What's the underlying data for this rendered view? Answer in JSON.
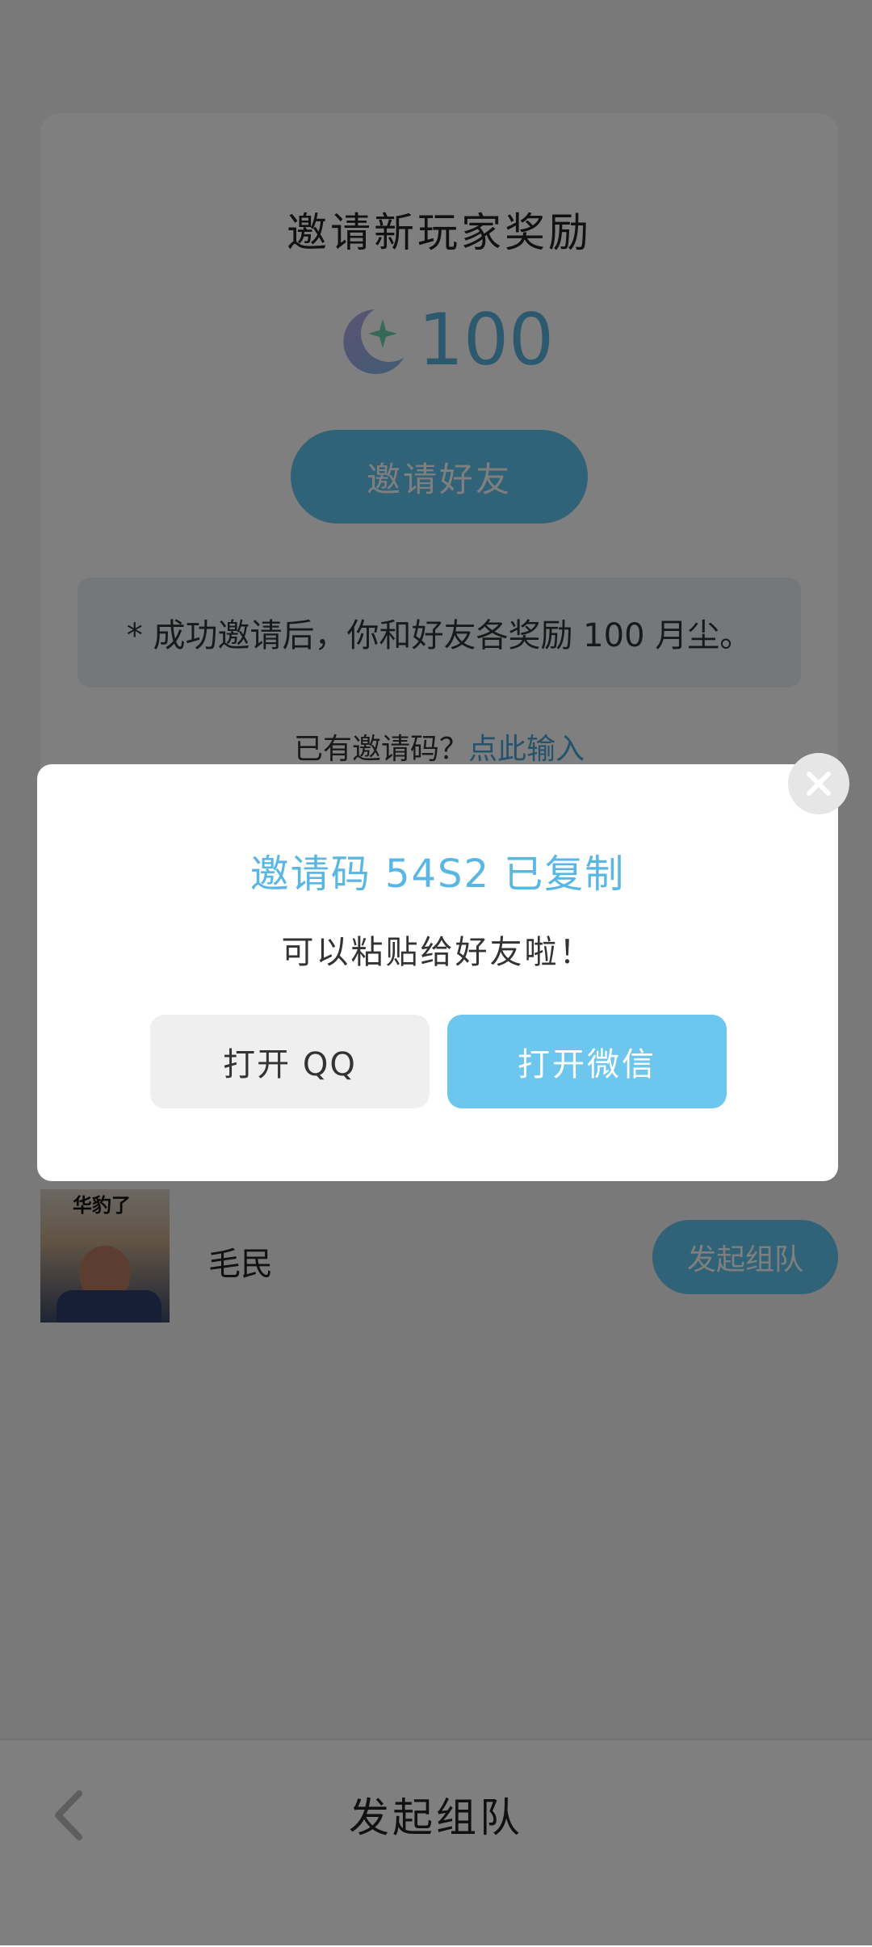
{
  "card": {
    "title": "邀请新玩家奖励",
    "reward_amount": "100",
    "reward_icon": "moon-star-icon",
    "invite_button": "邀请好友",
    "note": "* 成功邀请后，你和好友各奖励 100 月尘。",
    "have_code_text": "已有邀请码？",
    "have_code_link": "点此输入"
  },
  "friend": {
    "avatar_caption": "华豹了",
    "name": "毛民",
    "team_button": "发起组队"
  },
  "bottom_bar": {
    "back_icon": "chevron-left-icon",
    "title": "发起组队"
  },
  "dialog": {
    "title": "邀请码 54S2 已复制",
    "subtitle": "可以粘贴给好友啦！",
    "qq_button": "打开 QQ",
    "wechat_button": "打开微信",
    "close_icon": "close-icon"
  },
  "colors": {
    "accent": "#61c4f0",
    "link": "#4aa5d8",
    "dialog_title": "#5ab7e3"
  }
}
